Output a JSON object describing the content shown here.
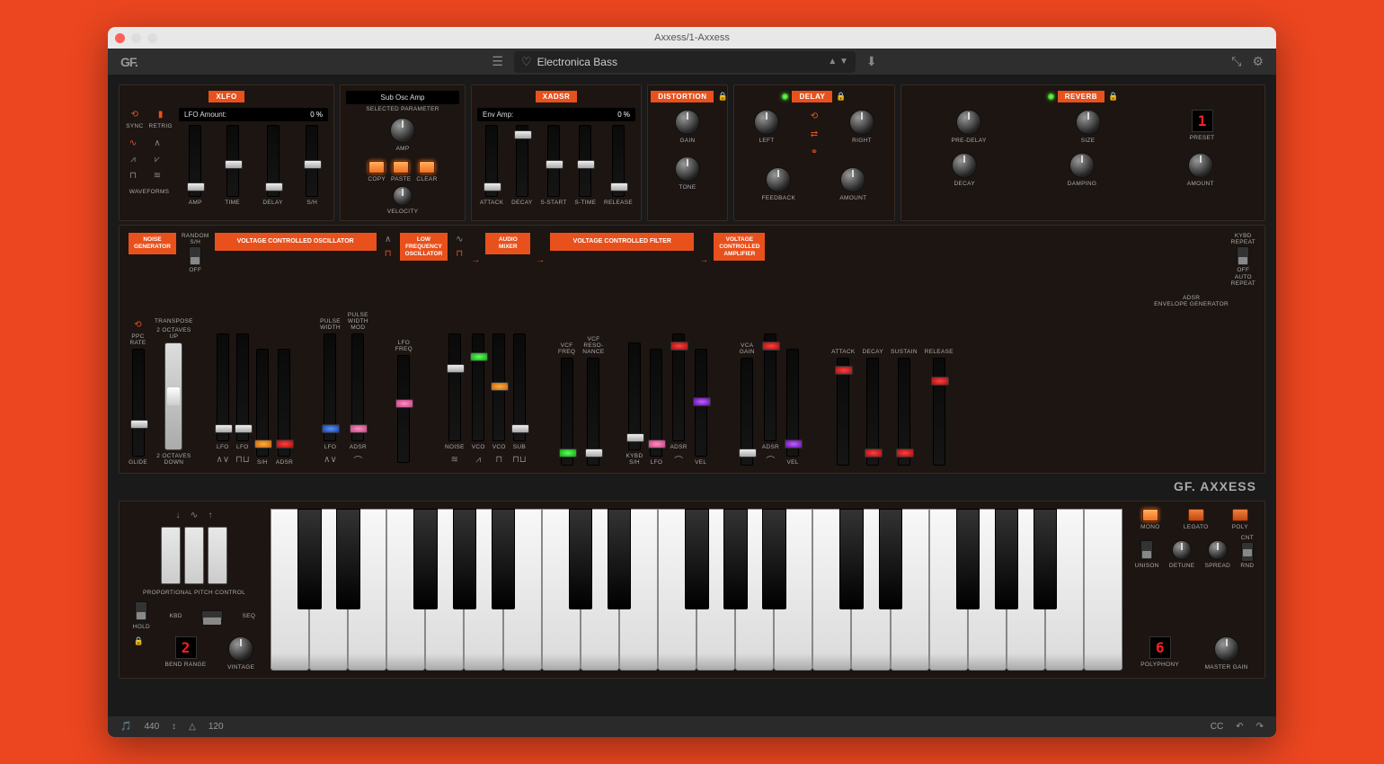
{
  "window": {
    "title": "Axxess/1-Axxess"
  },
  "toolbar": {
    "logo": "GF.",
    "preset": "Electronica Bass"
  },
  "top": {
    "xlfo": {
      "title": "XLFO",
      "sync": "SYNC",
      "retrig": "RETRIG",
      "waveforms": "WAVEFORMS",
      "lcd_label": "LFO Amount:",
      "lcd_value": "0 %",
      "sliders": [
        "AMP",
        "TIME",
        "DELAY",
        "S/H"
      ]
    },
    "param": {
      "lcd": "Sub Osc Amp",
      "sub": "SELECTED PARAMETER",
      "copy": "COPY",
      "paste": "PASTE",
      "clear": "CLEAR",
      "amp": "AMP",
      "velocity": "VELOCITY"
    },
    "xadsr": {
      "title": "XADSR",
      "lcd_label": "Env Amp:",
      "lcd_value": "0 %",
      "sliders": [
        "ATTACK",
        "DECAY",
        "S-START",
        "S-TIME",
        "RELEASE"
      ]
    },
    "distortion": {
      "title": "DISTORTION",
      "k1": "GAIN",
      "k2": "TONE"
    },
    "delay": {
      "title": "DELAY",
      "left": "LEFT",
      "right": "RIGHT",
      "fb": "FEEDBACK",
      "amt": "AMOUNT"
    },
    "reverb": {
      "title": "REVERB",
      "pre": "PRE-DELAY",
      "size": "SIZE",
      "preset": "PRESET",
      "preset_val": "1",
      "decay": "DECAY",
      "damp": "DAMPING",
      "amt": "AMOUNT"
    }
  },
  "signal": {
    "noise": "NOISE\nGENERATOR",
    "random": "RANDOM\nS/H",
    "off": "OFF",
    "vco": "VOLTAGE CONTROLLED OSCILLATOR",
    "lfo": "LOW\nFREQUENCY\nOSCILLATOR",
    "mixer": "AUDIO\nMIXER",
    "vcf": "VOLTAGE CONTROLLED FILTER",
    "vca": "VOLTAGE\nCONTROLLED\nAMPLIFIER",
    "kybd": "KYBD\nREPEAT",
    "kybd_off": "OFF",
    "auto": "AUTO\nREPEAT",
    "adsr_env": "ADSR\nENVELOPE GENERATOR"
  },
  "mid": {
    "ppc": "PPC\nRATE",
    "transpose": "TRANSPOSE",
    "up": "2 OCTAVES\nUP",
    "down": "2 OCTAVES\nDOWN",
    "glide": "GLIDE",
    "vco_sliders": [
      "LFO",
      "LFO",
      "S/H",
      "ADSR"
    ],
    "pw": "PULSE\nWIDTH",
    "pwm": "PULSE\nWIDTH\nMOD",
    "lfo_freq": "LFO\nFREQ",
    "lfo_sliders": [
      "LFO",
      "ADSR"
    ],
    "mixer_sliders": [
      "NOISE",
      "VCO",
      "VCO",
      "SUB"
    ],
    "vcf_freq": "VCF\nFREQ",
    "vcf_res": "VCF\nRESO-\nNANCE",
    "vcf_sliders": [
      "KYBD\nS/H",
      "LFO",
      "ADSR",
      "VEL"
    ],
    "vca_gain": "VCA\nGAIN",
    "vca_sliders": [
      "ADSR",
      "VEL"
    ],
    "env_sliders": [
      "ATTACK",
      "DECAY",
      "SUSTAIN",
      "RELEASE"
    ]
  },
  "brand": {
    "gf": "GF.",
    "name": "AXXESS"
  },
  "bottom": {
    "ppc_label": "PROPORTIONAL PITCH CONTROL",
    "hold": "HOLD",
    "kbd": "KBD",
    "seq": "SEQ",
    "bend_val": "2",
    "bend": "BEND RANGE",
    "vintage": "VINTAGE",
    "mono": "MONO",
    "legato": "LEGATO",
    "poly": "POLY",
    "unison": "UNISON",
    "detune": "DETUNE",
    "spread": "SPREAD",
    "cnt": "CNT",
    "rnd": "RND",
    "poly_val": "6",
    "poly_lbl": "POLYPHONY",
    "master": "MASTER GAIN"
  },
  "status": {
    "tune": "440",
    "tempo": "120",
    "cc": "CC"
  }
}
